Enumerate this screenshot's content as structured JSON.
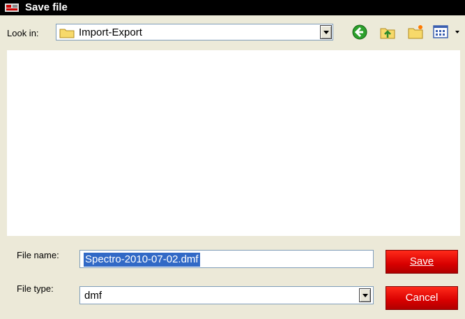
{
  "window": {
    "title": "Save file"
  },
  "toolbar": {
    "look_in_label": "Look in:",
    "look_in_value": "Import-Export",
    "icons": [
      "back-icon",
      "up-folder-icon",
      "new-folder-icon",
      "view-menu-icon"
    ]
  },
  "form": {
    "file_name_label": "File name:",
    "file_name_value": "Spectro-2010-07-02.dmf",
    "file_type_label": "File type:",
    "file_type_value": "dmf"
  },
  "buttons": {
    "save_label": "Save",
    "cancel_label": "Cancel"
  },
  "colors": {
    "button_red": "#e00000",
    "selection": "#3169c6",
    "titlebar": "#000000"
  }
}
